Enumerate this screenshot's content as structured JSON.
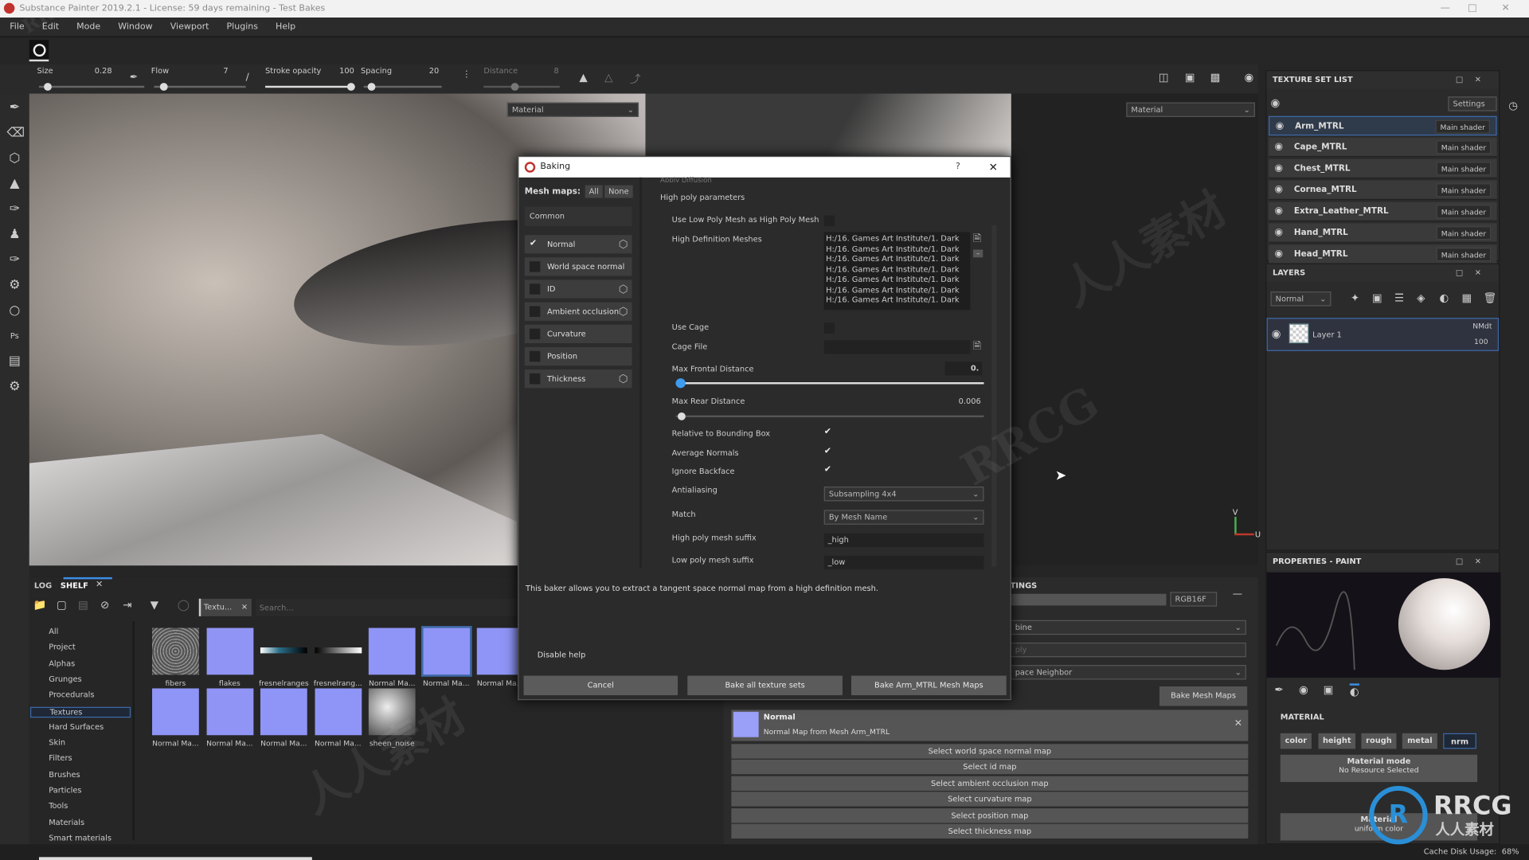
{
  "window": {
    "title": "Substance Painter 2019.2.1 - License: 59 days remaining - Test Bakes"
  },
  "menu": [
    "File",
    "Edit",
    "Mode",
    "Window",
    "Viewport",
    "Plugins",
    "Help"
  ],
  "brush_params": {
    "size_label": "Size",
    "size": "0.28",
    "size_level": 0.05,
    "flow_label": "Flow",
    "flow": "7",
    "flow_level": 0.07,
    "stroke_opacity_label": "Stroke opacity",
    "stroke_opacity": "100",
    "stroke_opacity_level": 1.0,
    "spacing_label": "Spacing",
    "spacing": "20",
    "spacing_level": 0.05,
    "distance_label": "Distance",
    "distance": "8",
    "distance_level": 0.4
  },
  "viewport": {
    "left_channel": "Material",
    "right_channel": "Material",
    "axis_y": "V",
    "axis_x": "U"
  },
  "texture_set_list": {
    "title": "TEXTURE SET LIST",
    "settings": "Settings",
    "items": [
      {
        "name": "Arm_MTRL",
        "shader": "Main shader",
        "selected": true
      },
      {
        "name": "Cape_MTRL",
        "shader": "Main shader"
      },
      {
        "name": "Chest_MTRL",
        "shader": "Main shader"
      },
      {
        "name": "Cornea_MTRL",
        "shader": "Main shader"
      },
      {
        "name": "Extra_Leather_MTRL",
        "shader": "Main shader"
      },
      {
        "name": "Hand_MTRL",
        "shader": "Main shader"
      },
      {
        "name": "Head_MTRL",
        "shader": "Main shader"
      }
    ]
  },
  "layers": {
    "title": "LAYERS",
    "blend_mode": "Normal",
    "layer": {
      "name": "Layer 1",
      "blend": "NMdt",
      "opacity": "100"
    }
  },
  "properties": {
    "title": "PROPERTIES - PAINT",
    "material_heading": "MATERIAL",
    "channels": [
      "color",
      "height",
      "rough",
      "metal",
      "nrm"
    ],
    "active_channel": "nrm",
    "mode_title": "Material mode",
    "mode_sub": "No Resource Selected",
    "second_title": "Material",
    "second_sub": "uniform color"
  },
  "shelf": {
    "tabs": [
      "LOG",
      "SHELF"
    ],
    "filter_tag": "Textu...",
    "search_placeholder": "Search...",
    "categories": [
      "All",
      "Project",
      "Alphas",
      "Grunges",
      "Procedurals",
      "Textures",
      "Hard Surfaces",
      "Skin",
      "Filters",
      "Brushes",
      "Particles",
      "Tools",
      "Materials",
      "Smart materials"
    ],
    "selected_category": "Textures",
    "items": [
      "fibers",
      "flakes",
      "fresnelranges",
      "fresnelrang...",
      "Normal Ma...",
      "Normal Ma...",
      "Normal Ma...",
      "Normal Ma...",
      "Normal Ma...",
      "Normal Ma...",
      "Normal Ma...",
      "sheen_noise"
    ]
  },
  "baking_settings": {
    "title_partial": "TINGS",
    "format": "RGB16F",
    "combine_partial": "bine",
    "apply_partial": "ply",
    "dilation_partial": "pace Neighbor",
    "bake_button": "Bake Mesh Maps",
    "normal_item": {
      "title": "Normal",
      "subtitle": "Normal Map from Mesh Arm_MTRL"
    },
    "select_buttons": [
      "Select world space normal map",
      "Select id map",
      "Select ambient occlusion map",
      "Select curvature map",
      "Select position map",
      "Select thickness map"
    ]
  },
  "dialog": {
    "title": "Baking",
    "help_btn": "?",
    "mesh_maps_label": "Mesh maps:",
    "all": "All",
    "none": "None",
    "common": "Common",
    "maps": [
      {
        "name": "Normal",
        "checked": true,
        "gear": true
      },
      {
        "name": "World space normal",
        "checked": false
      },
      {
        "name": "ID",
        "checked": false,
        "gear": true
      },
      {
        "name": "Ambient occlusion",
        "checked": false,
        "gear": true
      },
      {
        "name": "Curvature",
        "checked": false
      },
      {
        "name": "Position",
        "checked": false
      },
      {
        "name": "Thickness",
        "checked": false,
        "gear": true
      }
    ],
    "cut_label": "Apply Diffusion",
    "section": "High poly parameters",
    "use_low_as_high": "Use Low Poly Mesh as High Poly Mesh",
    "hd_meshes_label": "High Definition Meshes",
    "hd_meshes": [
      "H:/16. Games Art Institute/1. Dark",
      "H:/16. Games Art Institute/1. Dark",
      "H:/16. Games Art Institute/1. Dark",
      "H:/16. Games Art Institute/1. Dark",
      "H:/16. Games Art Institute/1. Dark",
      "H:/16. Games Art Institute/1. Dark",
      "H:/16. Games Art Institute/1. Dark"
    ],
    "use_cage": "Use Cage",
    "cage_file": "Cage File",
    "max_frontal": "Max Frontal Distance",
    "max_frontal_value": "0.",
    "max_frontal_level": 0.0,
    "max_rear": "Max Rear Distance",
    "max_rear_value": "0.006",
    "max_rear_level": 0.006,
    "relative_bbox": "Relative to Bounding Box",
    "average_normals": "Average Normals",
    "ignore_backface": "Ignore Backface",
    "antialiasing": "Antialiasing",
    "antialiasing_value": "Subsampling 4x4",
    "match": "Match",
    "match_value": "By Mesh Name",
    "high_suffix": "High poly mesh suffix",
    "high_suffix_value": "_high",
    "low_suffix": "Low poly mesh suffix",
    "low_suffix_value": "_low",
    "help_text": "This baker allows you to extract a tangent space normal map from a high definition mesh.",
    "disable_help": "Disable help",
    "cancel": "Cancel",
    "bake_all": "Bake all texture sets",
    "bake_current": "Bake Arm_MTRL Mesh Maps"
  },
  "status": {
    "cache_label": "Cache Disk Usage:",
    "cache_value": "68%"
  },
  "watermarks": [
    "RRCG",
    "人人素材"
  ]
}
